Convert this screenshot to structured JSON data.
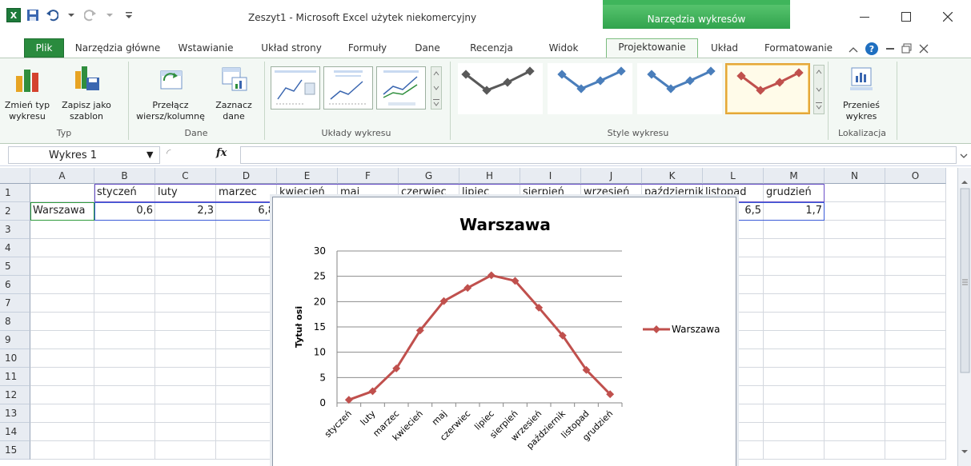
{
  "window": {
    "title": "Zeszyt1 - Microsoft Excel użytek niekomercyjny",
    "context_group": "Narzędzia wykresów"
  },
  "tabs": [
    {
      "label": "Plik"
    },
    {
      "label": "Narzędzia główne"
    },
    {
      "label": "Wstawianie"
    },
    {
      "label": "Układ strony"
    },
    {
      "label": "Formuły"
    },
    {
      "label": "Dane"
    },
    {
      "label": "Recenzja"
    },
    {
      "label": "Widok"
    },
    {
      "label": "Projektowanie"
    },
    {
      "label": "Układ"
    },
    {
      "label": "Formatowanie"
    }
  ],
  "ribbon": {
    "typ": {
      "label": "Typ",
      "change_type": "Zmień typ wykresu",
      "change_type_l1": "Zmień typ",
      "change_type_l2": "wykresu",
      "save_tpl_l1": "Zapisz jako",
      "save_tpl_l2": "szablon"
    },
    "dane": {
      "label": "Dane",
      "switch_l1": "Przełącz",
      "switch_l2": "wiersz/kolumnę",
      "select_l1": "Zaznacz",
      "select_l2": "dane"
    },
    "uklady": {
      "label": "Układy wykresu"
    },
    "style": {
      "label": "Style wykresu",
      "colors": [
        "#595959",
        "#4a7ebb",
        "#4a7ebb",
        "#c0504d"
      ]
    },
    "lokalizacja": {
      "label": "Lokalizacja",
      "move_l1": "Przenieś",
      "move_l2": "wykres"
    }
  },
  "formula_bar": {
    "name_box": "Wykres 1",
    "fx": "fx",
    "value": ""
  },
  "sheet": {
    "columns": [
      "A",
      "B",
      "C",
      "D",
      "E",
      "F",
      "G",
      "H",
      "I",
      "J",
      "K",
      "L",
      "M",
      "N",
      "O"
    ],
    "rows": [
      "1",
      "2",
      "3",
      "4",
      "5",
      "6",
      "7",
      "8",
      "9",
      "10",
      "11",
      "12",
      "13",
      "14",
      "15"
    ],
    "row1": [
      "",
      "styczeń",
      "luty",
      "marzec",
      "kwiecień",
      "maj",
      "czerwiec",
      "lipiec",
      "sierpień",
      "wrzesień",
      "październik",
      "listopad",
      "grudzień"
    ],
    "row2": [
      "Warszawa",
      "0,6",
      "2,3",
      "6,8",
      "",
      "",
      "",
      "",
      "",
      "",
      "",
      "6,5",
      "1,7"
    ]
  },
  "chart_data": {
    "type": "line",
    "title": "Warszawa",
    "ylabel": "Tytuł osi",
    "xlabel": "",
    "categories": [
      "styczeń",
      "luty",
      "marzec",
      "kwiecień",
      "maj",
      "czerwiec",
      "lipiec",
      "sierpień",
      "wrzesień",
      "październik",
      "listopad",
      "grudzień"
    ],
    "series": [
      {
        "name": "Warszawa",
        "color": "#c0504d",
        "values": [
          0.6,
          2.3,
          6.8,
          14.3,
          20.1,
          22.7,
          25.2,
          24.1,
          18.8,
          13.3,
          6.5,
          1.7
        ]
      }
    ],
    "ylim": [
      0,
      30
    ],
    "yticks": [
      "0",
      "5",
      "10",
      "15",
      "20",
      "25",
      "30"
    ],
    "grid": true,
    "legend": "right"
  }
}
